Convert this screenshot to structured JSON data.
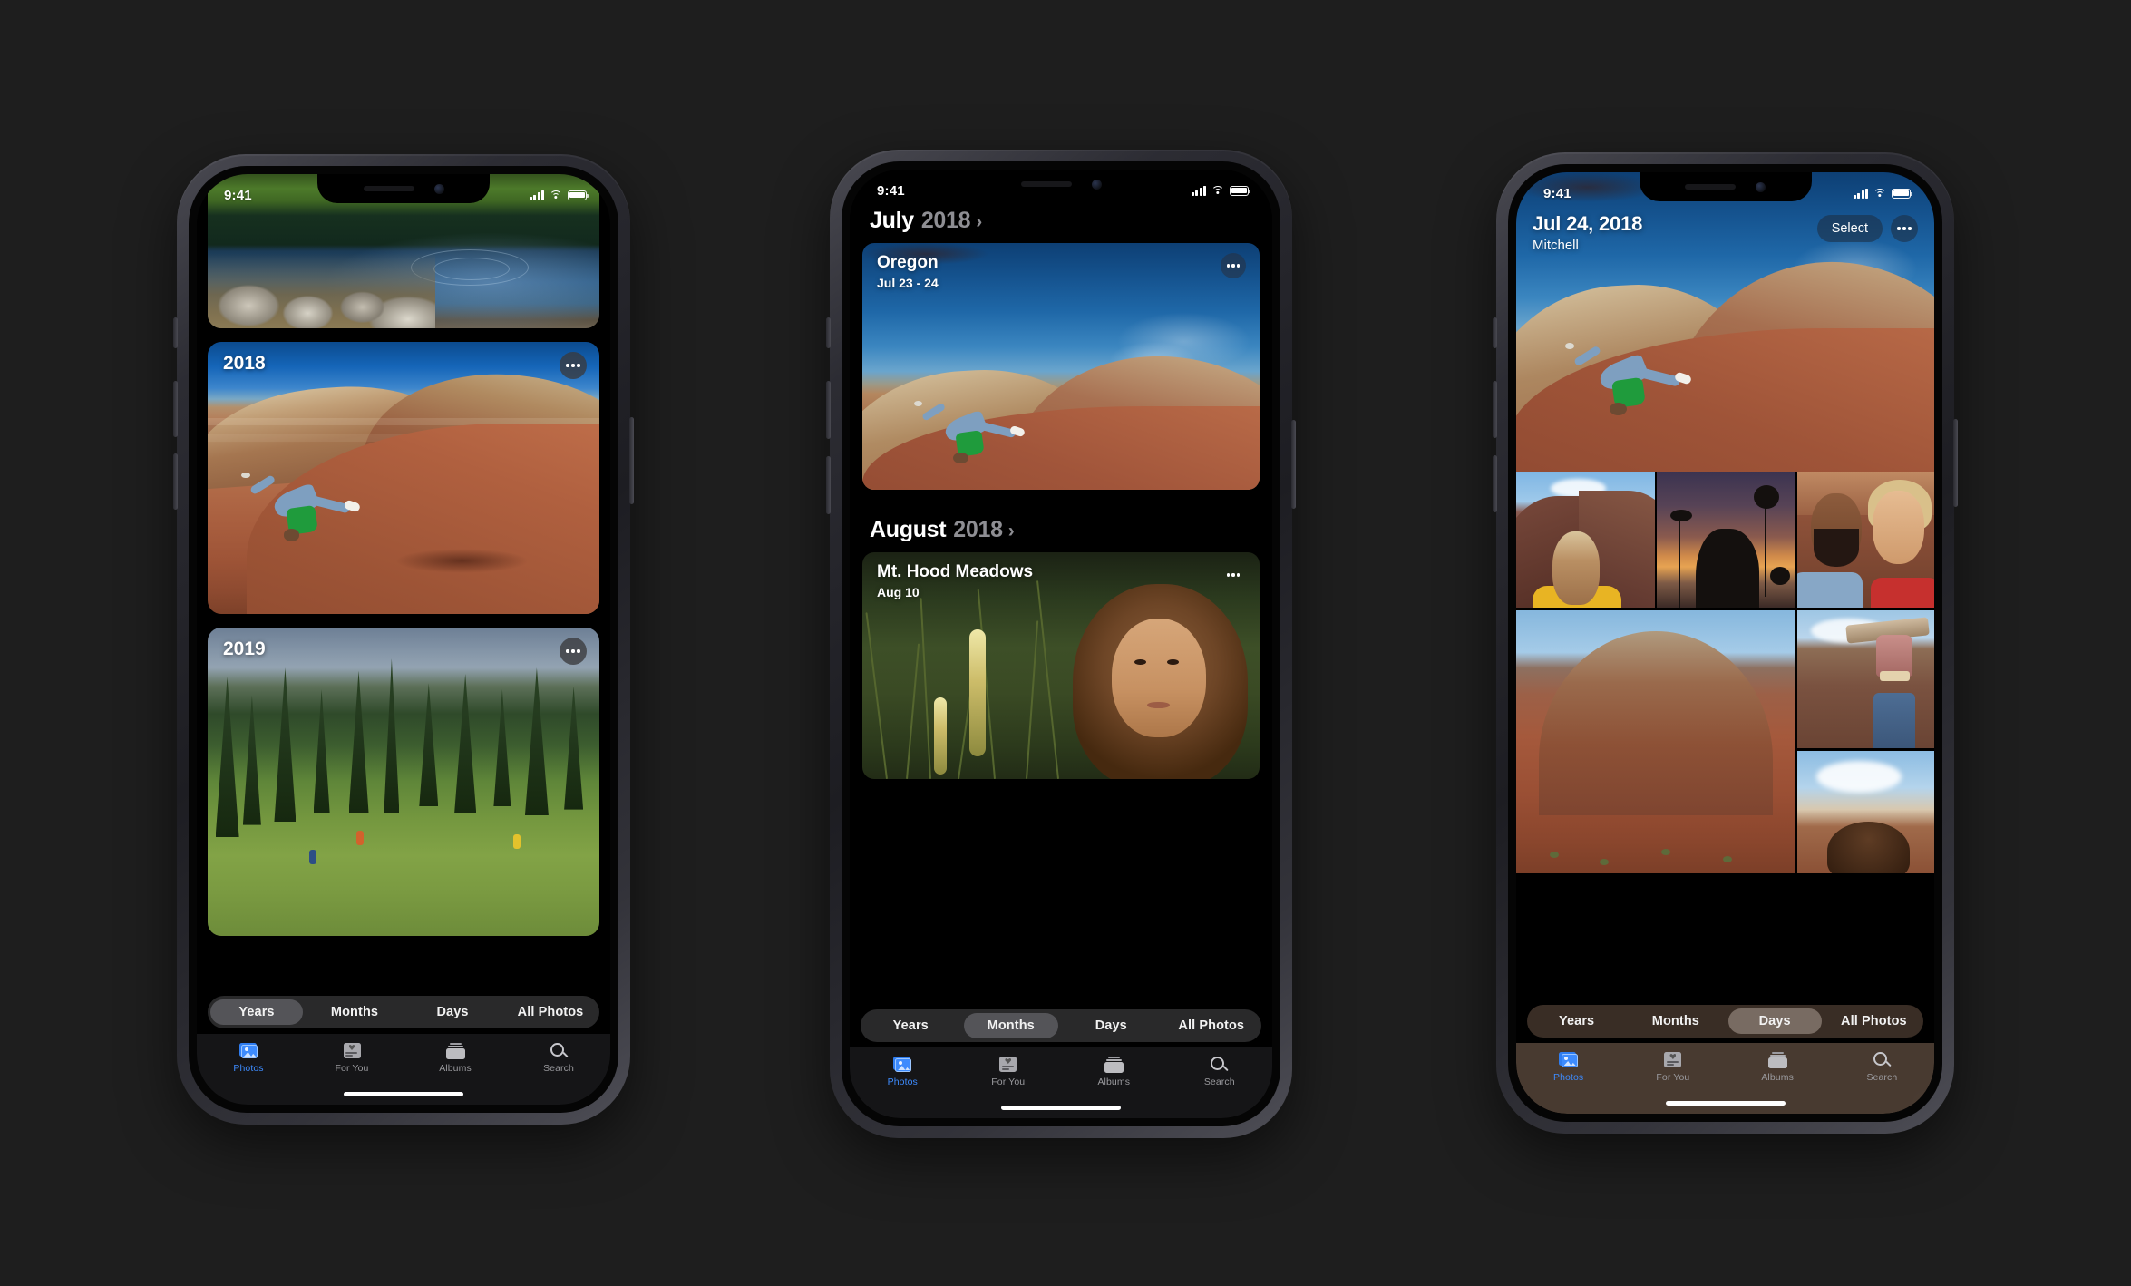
{
  "background_color": "#1e1e1e",
  "accent_color": "#3d8bfd",
  "phones": [
    {
      "id": "phone-years",
      "status_bar": {
        "time": "9:41",
        "signal": "signal-bars",
        "wifi": "wifi-icon",
        "battery": "battery-icon"
      },
      "screen_mode": "Years",
      "year_cards": [
        {
          "label": "",
          "photo": "lake-and-forest",
          "has_more": false
        },
        {
          "label": "2018",
          "photo": "painted-hills-cartwheel",
          "has_more": true
        },
        {
          "label": "2019",
          "photo": "alpine-meadow-hikers",
          "has_more": true
        }
      ],
      "segmented": {
        "options": [
          "Years",
          "Months",
          "Days",
          "All Photos"
        ],
        "selected": "Years"
      },
      "tabs": [
        {
          "label": "Photos",
          "icon": "photos-icon",
          "selected": true
        },
        {
          "label": "For You",
          "icon": "for-you-icon",
          "selected": false
        },
        {
          "label": "Albums",
          "icon": "albums-icon",
          "selected": false
        },
        {
          "label": "Search",
          "icon": "search-icon",
          "selected": false
        }
      ]
    },
    {
      "id": "phone-months",
      "status_bar": {
        "time": "9:41",
        "signal": "signal-bars",
        "wifi": "wifi-icon",
        "battery": "battery-icon"
      },
      "screen_mode": "Months",
      "sections": [
        {
          "month": "July",
          "year": "2018",
          "chevron": "chevron-right-icon",
          "card": {
            "title": "Oregon",
            "subtitle": "Jul 23 - 24",
            "photo": "oregon-painted-hills",
            "more": "more-options-icon"
          }
        },
        {
          "month": "August",
          "year": "2018",
          "chevron": "chevron-right-icon",
          "card": {
            "title": "Mt. Hood Meadows",
            "subtitle": "Aug 10",
            "photo": "meadow-portrait",
            "more": "more-options-icon"
          }
        }
      ],
      "segmented": {
        "options": [
          "Years",
          "Months",
          "Days",
          "All Photos"
        ],
        "selected": "Months"
      },
      "tabs": [
        {
          "label": "Photos",
          "icon": "photos-icon",
          "selected": true
        },
        {
          "label": "For You",
          "icon": "for-you-icon",
          "selected": false
        },
        {
          "label": "Albums",
          "icon": "albums-icon",
          "selected": false
        },
        {
          "label": "Search",
          "icon": "search-icon",
          "selected": false
        }
      ]
    },
    {
      "id": "phone-days",
      "status_bar": {
        "time": "9:41",
        "signal": "signal-bars",
        "wifi": "wifi-icon",
        "battery": "battery-icon"
      },
      "screen_mode": "Days",
      "header": {
        "title": "Jul 24, 2018",
        "subtitle": "Mitchell",
        "select_label": "Select",
        "more": "more-options-icon"
      },
      "photos": [
        {
          "name": "hero-cartwheel-painted-hills"
        },
        {
          "name": "boy-on-red-slope"
        },
        {
          "name": "sunflowers-at-sunset"
        },
        {
          "name": "couple-selfie"
        },
        {
          "name": "red-hill-landscape"
        },
        {
          "name": "hiking-boot-on-ledge"
        },
        {
          "name": "sky-and-hair"
        }
      ],
      "segmented": {
        "options": [
          "Years",
          "Months",
          "Days",
          "All Photos"
        ],
        "selected": "Days"
      },
      "tabs": [
        {
          "label": "Photos",
          "icon": "photos-icon",
          "selected": true
        },
        {
          "label": "For You",
          "icon": "for-you-icon",
          "selected": false
        },
        {
          "label": "Albums",
          "icon": "albums-icon",
          "selected": false
        },
        {
          "label": "Search",
          "icon": "search-icon",
          "selected": false
        }
      ]
    }
  ]
}
